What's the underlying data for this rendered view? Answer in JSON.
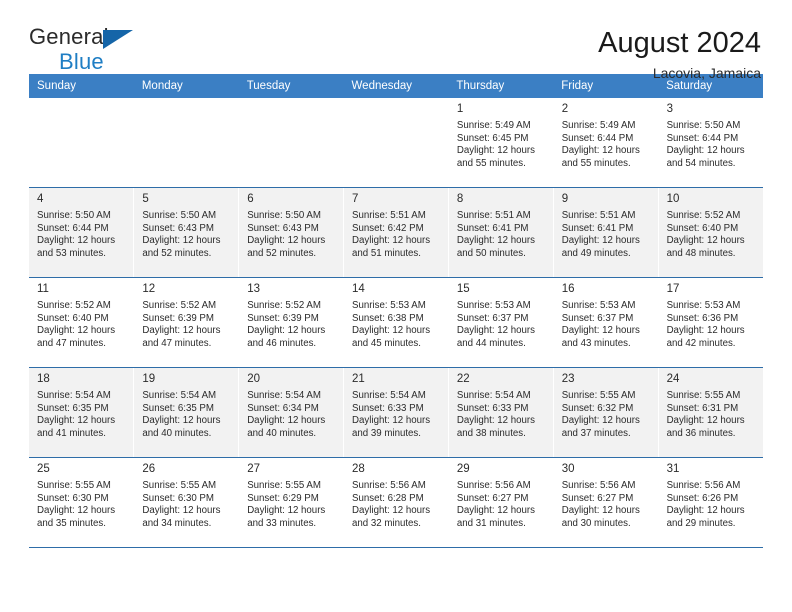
{
  "brand": {
    "name_part1": "General",
    "name_part2": "Blue",
    "triangle_color": "#1565a8",
    "blue_color": "#1f7ec4"
  },
  "header": {
    "title": "August 2024",
    "subtitle": "Lacovia, Jamaica"
  },
  "theme": {
    "header_bg": "#3b7fc4",
    "header_text": "#ffffff",
    "row_alt_bg": "#f2f2f2",
    "row_bg": "#ffffff",
    "grid_line": "#2e6da8"
  },
  "weekdays": [
    "Sunday",
    "Monday",
    "Tuesday",
    "Wednesday",
    "Thursday",
    "Friday",
    "Saturday"
  ],
  "weeks": [
    [
      {
        "day": "",
        "empty": true
      },
      {
        "day": "",
        "empty": true
      },
      {
        "day": "",
        "empty": true
      },
      {
        "day": "",
        "empty": true
      },
      {
        "day": "1",
        "sunrise": "Sunrise: 5:49 AM",
        "sunset": "Sunset: 6:45 PM",
        "daylight1": "Daylight: 12 hours",
        "daylight2": "and 55 minutes."
      },
      {
        "day": "2",
        "sunrise": "Sunrise: 5:49 AM",
        "sunset": "Sunset: 6:44 PM",
        "daylight1": "Daylight: 12 hours",
        "daylight2": "and 55 minutes."
      },
      {
        "day": "3",
        "sunrise": "Sunrise: 5:50 AM",
        "sunset": "Sunset: 6:44 PM",
        "daylight1": "Daylight: 12 hours",
        "daylight2": "and 54 minutes."
      }
    ],
    [
      {
        "day": "4",
        "sunrise": "Sunrise: 5:50 AM",
        "sunset": "Sunset: 6:44 PM",
        "daylight1": "Daylight: 12 hours",
        "daylight2": "and 53 minutes."
      },
      {
        "day": "5",
        "sunrise": "Sunrise: 5:50 AM",
        "sunset": "Sunset: 6:43 PM",
        "daylight1": "Daylight: 12 hours",
        "daylight2": "and 52 minutes."
      },
      {
        "day": "6",
        "sunrise": "Sunrise: 5:50 AM",
        "sunset": "Sunset: 6:43 PM",
        "daylight1": "Daylight: 12 hours",
        "daylight2": "and 52 minutes."
      },
      {
        "day": "7",
        "sunrise": "Sunrise: 5:51 AM",
        "sunset": "Sunset: 6:42 PM",
        "daylight1": "Daylight: 12 hours",
        "daylight2": "and 51 minutes."
      },
      {
        "day": "8",
        "sunrise": "Sunrise: 5:51 AM",
        "sunset": "Sunset: 6:41 PM",
        "daylight1": "Daylight: 12 hours",
        "daylight2": "and 50 minutes."
      },
      {
        "day": "9",
        "sunrise": "Sunrise: 5:51 AM",
        "sunset": "Sunset: 6:41 PM",
        "daylight1": "Daylight: 12 hours",
        "daylight2": "and 49 minutes."
      },
      {
        "day": "10",
        "sunrise": "Sunrise: 5:52 AM",
        "sunset": "Sunset: 6:40 PM",
        "daylight1": "Daylight: 12 hours",
        "daylight2": "and 48 minutes."
      }
    ],
    [
      {
        "day": "11",
        "sunrise": "Sunrise: 5:52 AM",
        "sunset": "Sunset: 6:40 PM",
        "daylight1": "Daylight: 12 hours",
        "daylight2": "and 47 minutes."
      },
      {
        "day": "12",
        "sunrise": "Sunrise: 5:52 AM",
        "sunset": "Sunset: 6:39 PM",
        "daylight1": "Daylight: 12 hours",
        "daylight2": "and 47 minutes."
      },
      {
        "day": "13",
        "sunrise": "Sunrise: 5:52 AM",
        "sunset": "Sunset: 6:39 PM",
        "daylight1": "Daylight: 12 hours",
        "daylight2": "and 46 minutes."
      },
      {
        "day": "14",
        "sunrise": "Sunrise: 5:53 AM",
        "sunset": "Sunset: 6:38 PM",
        "daylight1": "Daylight: 12 hours",
        "daylight2": "and 45 minutes."
      },
      {
        "day": "15",
        "sunrise": "Sunrise: 5:53 AM",
        "sunset": "Sunset: 6:37 PM",
        "daylight1": "Daylight: 12 hours",
        "daylight2": "and 44 minutes."
      },
      {
        "day": "16",
        "sunrise": "Sunrise: 5:53 AM",
        "sunset": "Sunset: 6:37 PM",
        "daylight1": "Daylight: 12 hours",
        "daylight2": "and 43 minutes."
      },
      {
        "day": "17",
        "sunrise": "Sunrise: 5:53 AM",
        "sunset": "Sunset: 6:36 PM",
        "daylight1": "Daylight: 12 hours",
        "daylight2": "and 42 minutes."
      }
    ],
    [
      {
        "day": "18",
        "sunrise": "Sunrise: 5:54 AM",
        "sunset": "Sunset: 6:35 PM",
        "daylight1": "Daylight: 12 hours",
        "daylight2": "and 41 minutes."
      },
      {
        "day": "19",
        "sunrise": "Sunrise: 5:54 AM",
        "sunset": "Sunset: 6:35 PM",
        "daylight1": "Daylight: 12 hours",
        "daylight2": "and 40 minutes."
      },
      {
        "day": "20",
        "sunrise": "Sunrise: 5:54 AM",
        "sunset": "Sunset: 6:34 PM",
        "daylight1": "Daylight: 12 hours",
        "daylight2": "and 40 minutes."
      },
      {
        "day": "21",
        "sunrise": "Sunrise: 5:54 AM",
        "sunset": "Sunset: 6:33 PM",
        "daylight1": "Daylight: 12 hours",
        "daylight2": "and 39 minutes."
      },
      {
        "day": "22",
        "sunrise": "Sunrise: 5:54 AM",
        "sunset": "Sunset: 6:33 PM",
        "daylight1": "Daylight: 12 hours",
        "daylight2": "and 38 minutes."
      },
      {
        "day": "23",
        "sunrise": "Sunrise: 5:55 AM",
        "sunset": "Sunset: 6:32 PM",
        "daylight1": "Daylight: 12 hours",
        "daylight2": "and 37 minutes."
      },
      {
        "day": "24",
        "sunrise": "Sunrise: 5:55 AM",
        "sunset": "Sunset: 6:31 PM",
        "daylight1": "Daylight: 12 hours",
        "daylight2": "and 36 minutes."
      }
    ],
    [
      {
        "day": "25",
        "sunrise": "Sunrise: 5:55 AM",
        "sunset": "Sunset: 6:30 PM",
        "daylight1": "Daylight: 12 hours",
        "daylight2": "and 35 minutes."
      },
      {
        "day": "26",
        "sunrise": "Sunrise: 5:55 AM",
        "sunset": "Sunset: 6:30 PM",
        "daylight1": "Daylight: 12 hours",
        "daylight2": "and 34 minutes."
      },
      {
        "day": "27",
        "sunrise": "Sunrise: 5:55 AM",
        "sunset": "Sunset: 6:29 PM",
        "daylight1": "Daylight: 12 hours",
        "daylight2": "and 33 minutes."
      },
      {
        "day": "28",
        "sunrise": "Sunrise: 5:56 AM",
        "sunset": "Sunset: 6:28 PM",
        "daylight1": "Daylight: 12 hours",
        "daylight2": "and 32 minutes."
      },
      {
        "day": "29",
        "sunrise": "Sunrise: 5:56 AM",
        "sunset": "Sunset: 6:27 PM",
        "daylight1": "Daylight: 12 hours",
        "daylight2": "and 31 minutes."
      },
      {
        "day": "30",
        "sunrise": "Sunrise: 5:56 AM",
        "sunset": "Sunset: 6:27 PM",
        "daylight1": "Daylight: 12 hours",
        "daylight2": "and 30 minutes."
      },
      {
        "day": "31",
        "sunrise": "Sunrise: 5:56 AM",
        "sunset": "Sunset: 6:26 PM",
        "daylight1": "Daylight: 12 hours",
        "daylight2": "and 29 minutes."
      }
    ]
  ]
}
